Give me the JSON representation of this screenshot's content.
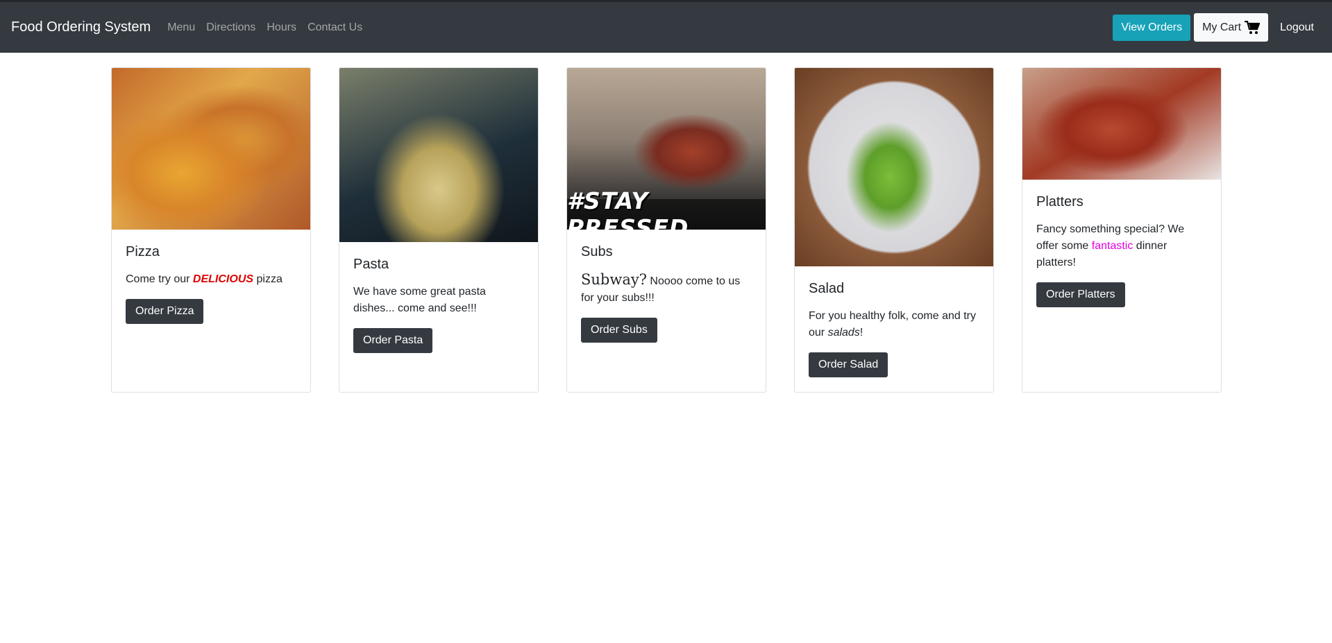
{
  "navbar": {
    "brand": "Food Ordering System",
    "links": [
      "Menu",
      "Directions",
      "Hours",
      "Contact Us"
    ],
    "view_orders": "View Orders",
    "my_cart": "My Cart",
    "logout": "Logout"
  },
  "cards": [
    {
      "title": "Pizza",
      "text_before": "Come try our ",
      "text_em": "DELICIOUS",
      "text_after": " pizza",
      "button": "Order Pizza"
    },
    {
      "title": "Pasta",
      "text": "We have some great pasta dishes... come and see!!!",
      "button": "Order Pasta"
    },
    {
      "title": "Subs",
      "image_text": "#STAY PRESSED",
      "text_big": "Subway?",
      "text_rest": " Noooo come to us for your subs!!!",
      "button": "Order Subs"
    },
    {
      "title": "Salad",
      "text_before": "For you healthy folk, come and try our ",
      "text_em": "salads",
      "text_after": "!",
      "button": "Order Salad"
    },
    {
      "title": "Platters",
      "text_before": "Fancy something special? We offer some ",
      "text_highlight": "fantastic",
      "text_after": " dinner platters!",
      "button": "Order Platters"
    }
  ],
  "colors": {
    "navbar": "#343a40",
    "info_button": "#17a2b8",
    "dark_button": "#343a40",
    "delicious": "#e00000",
    "fantastic": "#e100e1"
  },
  "icons": {
    "cart": "shopping-cart-icon"
  }
}
